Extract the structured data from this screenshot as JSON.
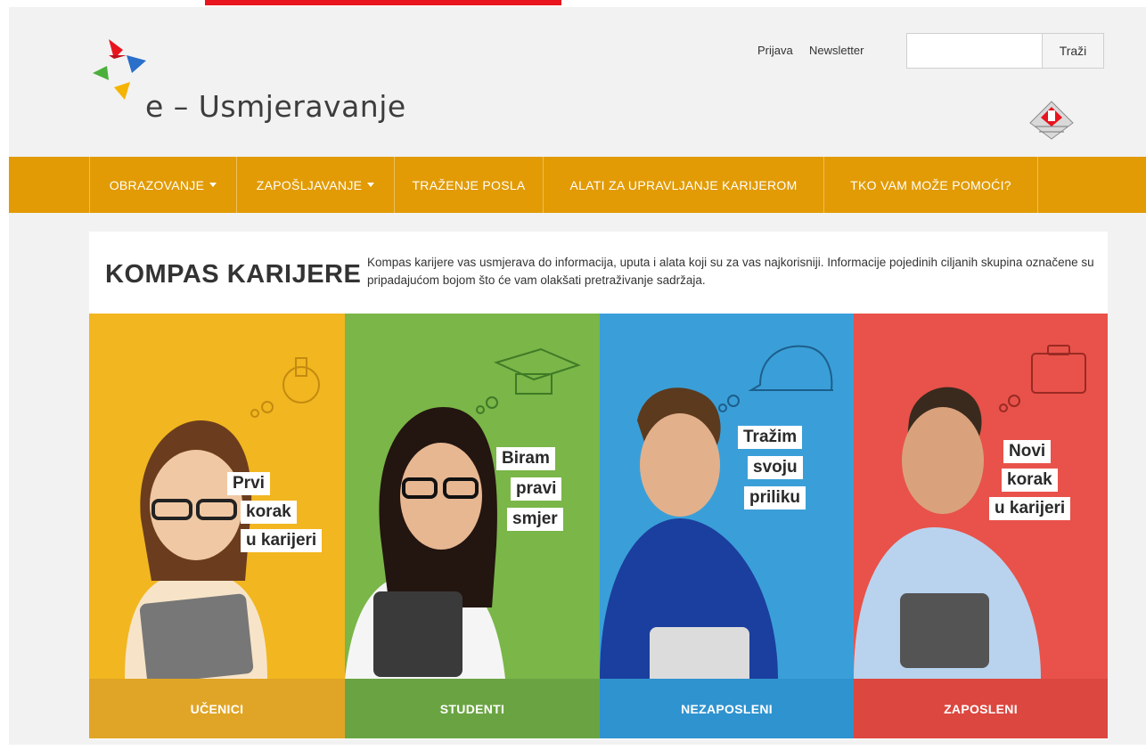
{
  "header": {
    "logo_text": "e – Usmjeravanje",
    "links": {
      "login": "Prijava",
      "newsletter": "Newsletter"
    },
    "search": {
      "placeholder": "",
      "button_label": "Traži"
    }
  },
  "nav": {
    "items": [
      {
        "label": "OBRAZOVANJE",
        "dropdown": true
      },
      {
        "label": "ZAPOŠLJAVANJE",
        "dropdown": true
      },
      {
        "label": "TRAŽENJE POSLA",
        "dropdown": false
      },
      {
        "label": "ALATI ZA UPRAVLJANJE KARIJEROM",
        "dropdown": false
      },
      {
        "label": "TKO VAM MOŽE POMOĆI?",
        "dropdown": false
      }
    ]
  },
  "kompas": {
    "title": "KOMPAS KARIJERE",
    "description": "Kompas karijere vas usmjerava do informacija, uputa i alata koji su za vas najkorisniji. Informacije pojedinih ciljanih skupina označene su pripadajućom bojom što će vam olakšati pretraživanje sadržaja."
  },
  "groups": [
    {
      "label": "UČENICI",
      "tagline": [
        "Prvi",
        "korak",
        "u karijeri"
      ],
      "color": "#f2b620",
      "label_color": "#e0a526"
    },
    {
      "label": "STUDENTI",
      "tagline": [
        "Biram",
        "pravi",
        "smjer"
      ],
      "color": "#7ab648",
      "label_color": "#6aa442"
    },
    {
      "label": "NEZAPOSLENI",
      "tagline": [
        "Tražim",
        "svoju",
        "priliku"
      ],
      "color": "#3a9fd8",
      "label_color": "#2f93cf"
    },
    {
      "label": "ZAPOSLENI",
      "tagline": [
        "Novi",
        "korak",
        "u karijeri"
      ],
      "color": "#e8524a",
      "label_color": "#dc473f"
    }
  ],
  "colors": {
    "nav": "#e29b04",
    "accent_red": "#e8141e"
  }
}
